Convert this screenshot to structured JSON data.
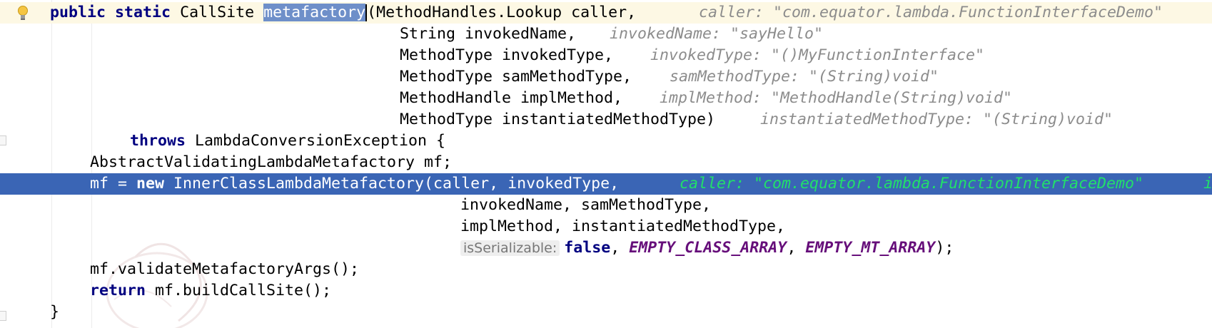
{
  "editor": {
    "colors": {
      "keyword": "#000080",
      "hint": "#8c8c8c",
      "selection_line": "#3a65b5",
      "current_line": "#fdf8e4",
      "word_highlight": "#6e8fc9",
      "constant": "#660e7a",
      "hint_on_selection": "#22e06a"
    },
    "gutter_icon": "lightbulb-icon",
    "lines": {
      "l1": {
        "kw1": "public",
        "kw2": "static",
        "type": "CallSite",
        "method": "metafactory",
        "rest": "(MethodHandles.Lookup caller,",
        "hint": "caller: \"com.equator.lambda.FunctionInterfaceDemo\""
      },
      "l2": {
        "code": "String invokedName,",
        "hint": "invokedName: \"sayHello\""
      },
      "l3": {
        "code": "MethodType invokedType,",
        "hint": "invokedType: \"()MyFunctionInterface\""
      },
      "l4": {
        "code": "MethodType samMethodType,",
        "hint": "samMethodType: \"(String)void\""
      },
      "l5": {
        "code": "MethodHandle implMethod,",
        "hint": "implMethod: \"MethodHandle(String)void\""
      },
      "l6": {
        "code": "MethodType instantiatedMethodType)",
        "hint": "instantiatedMethodType: \"(String)void\""
      },
      "l7": {
        "kw": "throws",
        "code": "LambdaConversionException {"
      },
      "l8": {
        "code": "AbstractValidatingLambdaMetafactory mf;"
      },
      "l9": {
        "pre": "mf = ",
        "kw": "new",
        "code": "InnerClassLambdaMetafactory(caller, invokedType,",
        "hint": "caller: \"com.equator.lambda.FunctionInterfaceDemo\"",
        "hint_tail": "i"
      },
      "l10": {
        "code": "invokedName, samMethodType,"
      },
      "l11": {
        "code": "implMethod, instantiatedMethodType,"
      },
      "l12": {
        "param_hint": "isSerializable:",
        "kw": "false",
        "sep1": ", ",
        "const1": "EMPTY_CLASS_ARRAY",
        "sep2": ", ",
        "const2": "EMPTY_MT_ARRAY",
        "end": ");"
      },
      "l13": {
        "code": "mf.validateMetafactoryArgs();"
      },
      "l14": {
        "kw": "return",
        "code": "mf.buildCallSite();"
      },
      "l15": {
        "code": "}"
      }
    }
  }
}
